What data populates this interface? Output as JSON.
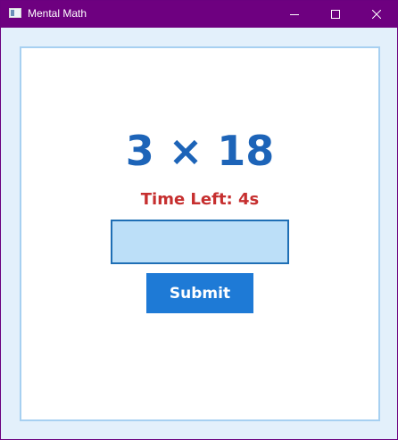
{
  "window": {
    "title": "Mental Math",
    "title_bar_color": "#6e0080",
    "controls": [
      "minimize-icon",
      "maximize-icon",
      "close-icon"
    ]
  },
  "quiz": {
    "question": "3 × 18",
    "timer_text": "Time Left: 4s",
    "answer_value": "",
    "submit_label": "Submit"
  },
  "colors": {
    "question": "#1d64b8",
    "timer": "#c62f2f",
    "input_fill": "#bcdff8",
    "submit_fill": "#1e7ad6"
  }
}
